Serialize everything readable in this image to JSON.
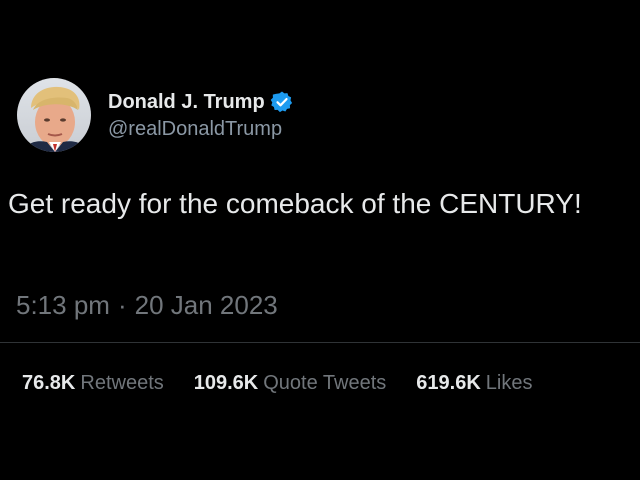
{
  "user": {
    "display_name": "Donald J. Trump",
    "handle": "@realDonaldTrump",
    "verified": true,
    "avatar_icon": "profile-photo"
  },
  "tweet": {
    "text": "Get ready for the comeback of the CENTURY!",
    "time": "5:13 pm",
    "separator": "·",
    "date": "20 Jan 2023"
  },
  "stats": {
    "retweets": {
      "count": "76.8K",
      "label": "Retweets"
    },
    "quote_tweets": {
      "count": "109.6K",
      "label": "Quote Tweets"
    },
    "likes": {
      "count": "619.6K",
      "label": "Likes"
    }
  },
  "colors": {
    "background": "#000000",
    "primary_text": "#e7e9ea",
    "secondary_text": "#71767b",
    "verified_badge": "#1d9bf0",
    "divider": "#2f3336"
  }
}
